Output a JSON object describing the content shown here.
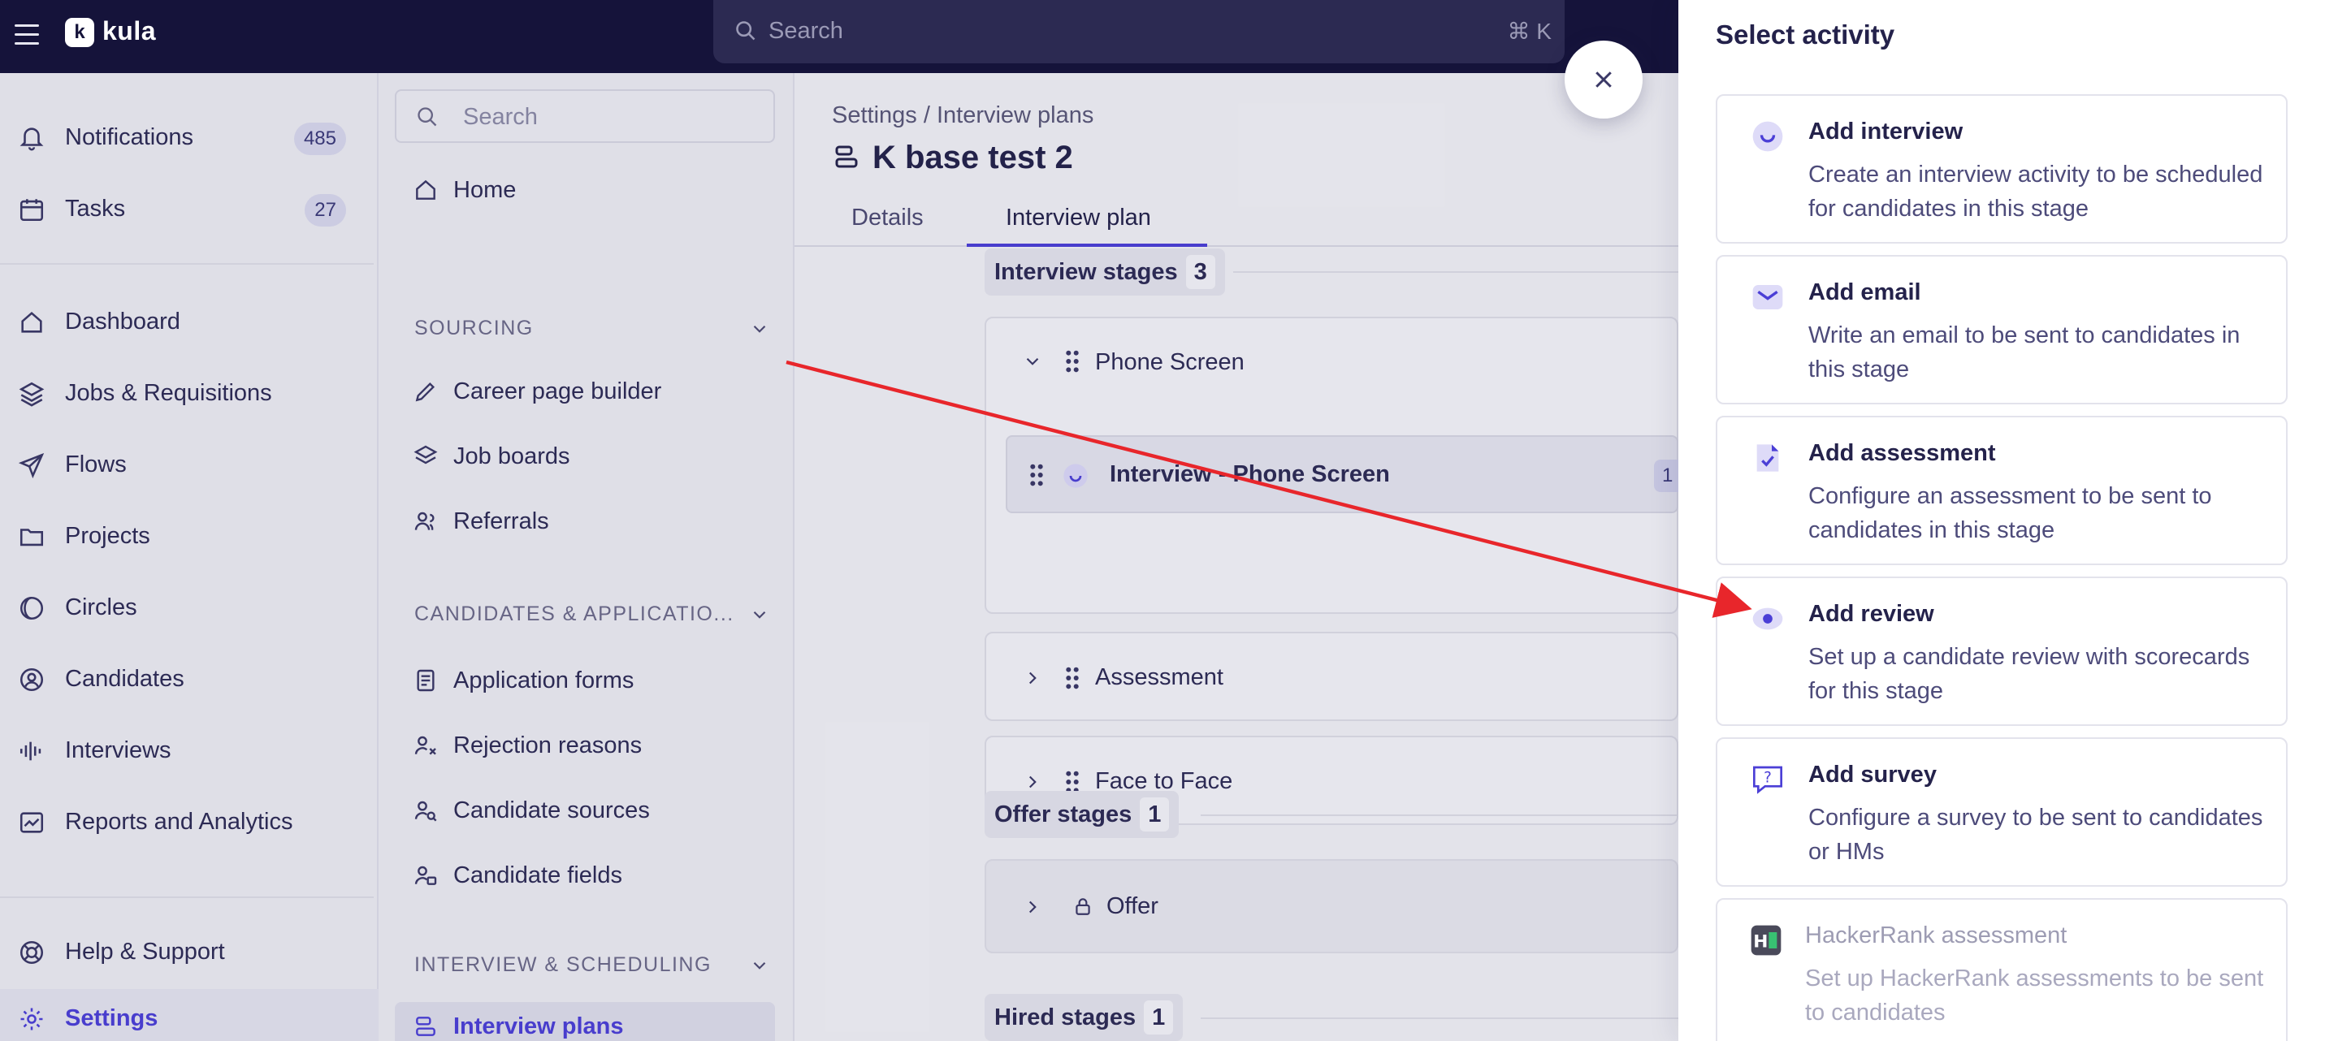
{
  "topbar": {
    "logo_mark": "k",
    "logo_text": "kula",
    "search_placeholder": "Search",
    "search_shortcut": "⌘ K"
  },
  "leftnav": {
    "items": [
      {
        "label": "Notifications",
        "badge": "485",
        "icon": "bell-icon"
      },
      {
        "label": "Tasks",
        "badge": "27",
        "icon": "calendar-icon"
      },
      {
        "label": "Dashboard",
        "icon": "home-icon"
      },
      {
        "label": "Jobs & Requisitions",
        "icon": "layers-icon"
      },
      {
        "label": "Flows",
        "icon": "send-icon"
      },
      {
        "label": "Projects",
        "icon": "folder-icon"
      },
      {
        "label": "Circles",
        "icon": "circles-icon"
      },
      {
        "label": "Candidates",
        "icon": "user-circle-icon"
      },
      {
        "label": "Interviews",
        "icon": "waveform-icon"
      },
      {
        "label": "Reports and Analytics",
        "icon": "chart-icon"
      },
      {
        "label": "Help & Support",
        "icon": "help-icon"
      },
      {
        "label": "Settings",
        "icon": "gear-icon"
      }
    ]
  },
  "subnav": {
    "search_placeholder": "Search",
    "home": "Home",
    "sections": [
      {
        "title": "SOURCING",
        "items": [
          "Career page builder",
          "Job boards",
          "Referrals"
        ]
      },
      {
        "title": "CANDIDATES & APPLICATIO...",
        "items": [
          "Application forms",
          "Rejection reasons",
          "Candidate sources",
          "Candidate fields"
        ]
      },
      {
        "title": "INTERVIEW & SCHEDULING",
        "items": [
          "Interview plans"
        ]
      }
    ]
  },
  "main": {
    "breadcrumb": "Settings / Interview plans",
    "title": "K base test 2",
    "tabs": [
      "Details",
      "Interview plan"
    ],
    "interview_stages": {
      "label": "Interview stages",
      "count": "3"
    },
    "stages": [
      {
        "name": "Phone Screen",
        "activity": "Interview - Phone Screen",
        "activity_badge": "1"
      },
      {
        "name": "Assessment"
      },
      {
        "name": "Face to Face"
      }
    ],
    "offer_stages": {
      "label": "Offer stages",
      "count": "1",
      "stage": "Offer"
    },
    "hired_stages": {
      "label": "Hired stages",
      "count": "1"
    }
  },
  "drawer": {
    "title": "Select activity",
    "options": [
      {
        "title": "Add interview",
        "desc": "Create an interview activity to be scheduled for candidates in this stage",
        "icon": "interview-icon"
      },
      {
        "title": "Add email",
        "desc": "Write an email to be sent to candidates in this stage",
        "icon": "email-icon"
      },
      {
        "title": "Add assessment",
        "desc": "Configure an assessment to be sent to candidates in this stage",
        "icon": "assessment-icon"
      },
      {
        "title": "Add review",
        "desc": "Set up a candidate review with scorecards for this stage",
        "icon": "review-icon"
      },
      {
        "title": "Add survey",
        "desc": "Configure a survey to be sent to candidates or HMs",
        "icon": "survey-icon"
      },
      {
        "title": "HackerRank assessment",
        "desc": "Set up HackerRank assessments to be sent to candidates",
        "icon": "hackerrank-icon"
      }
    ]
  },
  "colors": {
    "topbar": "#15133a",
    "accent": "#4b3fd6",
    "arrow": "#e8262b"
  }
}
